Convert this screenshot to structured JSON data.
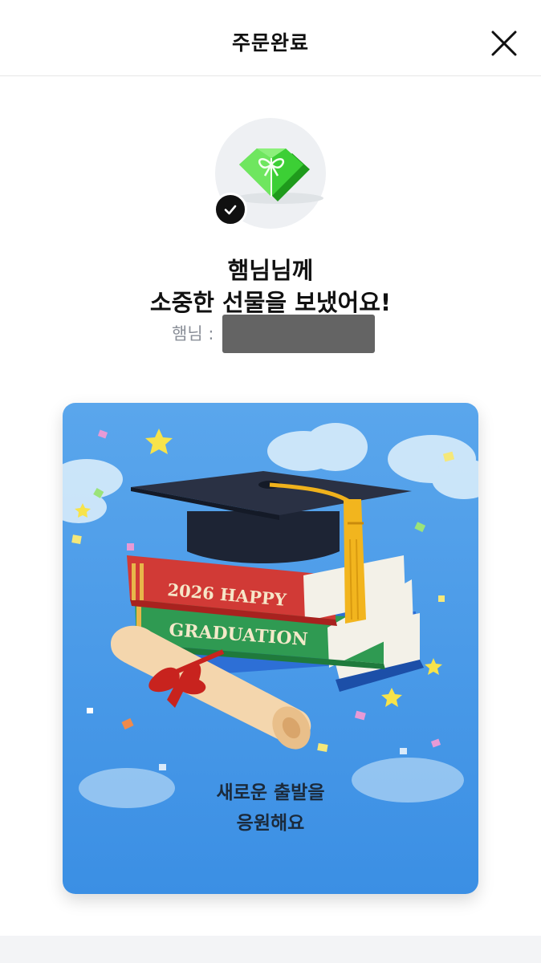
{
  "header": {
    "title": "주문완료",
    "close_icon": "close-icon"
  },
  "gift": {
    "icon": "gift-heart-icon",
    "check_icon": "check-icon"
  },
  "message": {
    "line1": "햄님님께",
    "line2": "소중한 선물을 보냈어요!",
    "recipient_label": "햄님 :"
  },
  "card": {
    "book_top_text": "2026 HAPPY",
    "book_mid_text": "GRADUATION",
    "message_line1": "새로운 출발을",
    "message_line2": "응원해요"
  },
  "colors": {
    "accent_green": "#3dd13a",
    "card_sky": "#4a9be8"
  }
}
